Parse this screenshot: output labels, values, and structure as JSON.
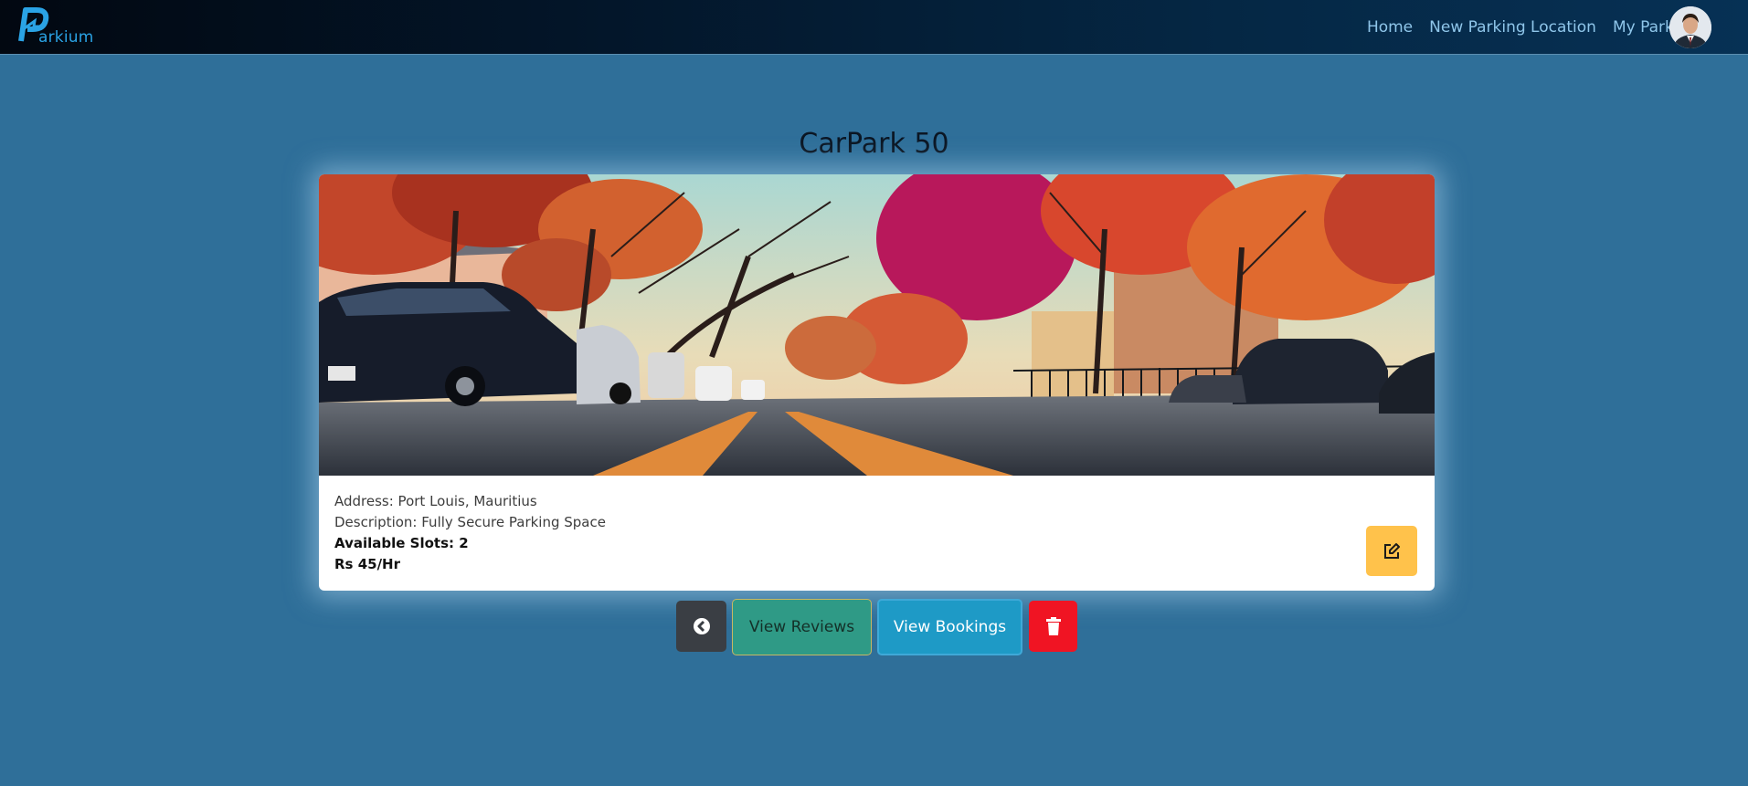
{
  "brand": {
    "name": "arkium",
    "logo_letter": "P",
    "color": "#2aa3e5"
  },
  "nav": {
    "items": [
      {
        "label": "Home"
      },
      {
        "label": "New Parking Location"
      },
      {
        "label": "My Parkings"
      }
    ],
    "avatar_icon": "user-avatar-icon"
  },
  "page": {
    "title": "CarPark 50"
  },
  "parking": {
    "image_icon": "street-photo",
    "address": "Address: Port Louis, Mauritius",
    "description": "Description: Fully Secure Parking Space",
    "available_slots": "Available Slots: 2",
    "rate": "Rs 45/Hr",
    "edit_icon": "edit-icon"
  },
  "actions": {
    "back_icon": "chevron-left-circle-icon",
    "view_reviews_label": "View Reviews",
    "view_bookings_label": "View Bookings",
    "delete_icon": "trash-icon"
  },
  "colors": {
    "background": "#2f6f99",
    "navbar": "#03162a",
    "edit": "#ffc24b",
    "back": "#3a3e44",
    "reviews": "#2f9a86",
    "bookings": "#1e9ac6",
    "delete": "#f01423"
  }
}
